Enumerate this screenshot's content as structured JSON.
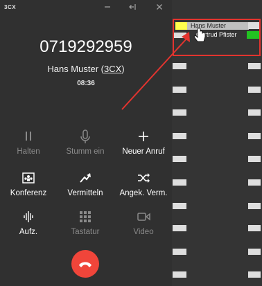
{
  "titlebar": {
    "logo": "3CX",
    "minimize_icon": "minimize-icon",
    "collapse_icon": "collapse-left-icon",
    "close_icon": "close-icon"
  },
  "call": {
    "number": "0719292959",
    "caller_name": "Hans Muster",
    "caller_source": "3CX",
    "duration": "08:36"
  },
  "actions": [
    {
      "label": "Halten",
      "icon": "pause-icon",
      "enabled": false
    },
    {
      "label": "Stumm ein",
      "icon": "microphone-icon",
      "enabled": false
    },
    {
      "label": "Neuer Anruf",
      "icon": "plus-icon",
      "enabled": true
    },
    {
      "label": "Konferenz",
      "icon": "conference-icon",
      "enabled": true
    },
    {
      "label": "Vermitteln",
      "icon": "transfer-icon",
      "enabled": true
    },
    {
      "label": "Angek. Verm.",
      "icon": "shuffle-icon",
      "enabled": true
    },
    {
      "label": "Aufz.",
      "icon": "waveform-icon",
      "enabled": true
    },
    {
      "label": "Tastatur",
      "icon": "keypad-icon",
      "enabled": false
    },
    {
      "label": "Video",
      "icon": "video-icon",
      "enabled": false
    }
  ],
  "hangup_icon": "hangup-icon",
  "presence_panel": {
    "entries": [
      {
        "name": "Hans Muster",
        "status_color": "#ffff4d"
      },
      {
        "name": "Gertrud Pfister",
        "status_color": "#22c322"
      }
    ]
  },
  "colors": {
    "accent_red": "#f0453a",
    "annotation": "#e3342f"
  }
}
